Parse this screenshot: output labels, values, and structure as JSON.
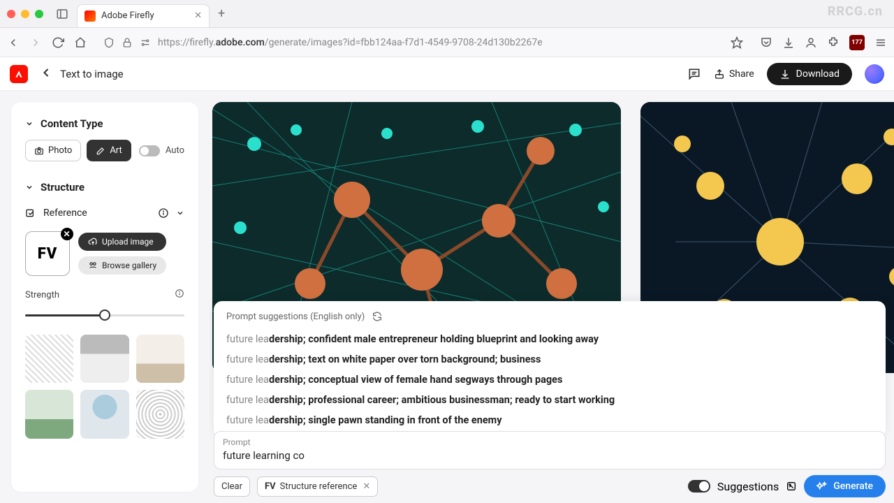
{
  "browser": {
    "tab_title": "Adobe Firefly",
    "url_prefix": "https://firefly.",
    "url_domain": "adobe.com",
    "url_path": "/generate/images?id=fbb124aa-f7d1-4549-9708-24d130b2267e",
    "ublock_badge": "177",
    "new_tab_symbol": "+"
  },
  "header": {
    "breadcrumb": "Text to image",
    "share_label": "Share",
    "download_label": "Download"
  },
  "sidebar": {
    "content_type_label": "Content Type",
    "photo_label": "Photo",
    "art_label": "Art",
    "auto_label": "Auto",
    "structure_label": "Structure",
    "reference_label": "Reference",
    "ref_thumb_text": "FV",
    "upload_label": "Upload image",
    "browse_label": "Browse gallery",
    "strength_label": "Strength"
  },
  "popover": {
    "heading": "Prompt suggestions (English only)",
    "prefix_text": "future lea",
    "items": [
      "dership; confident male entrepreneur holding blueprint and looking away",
      "dership; text on white paper over torn background; business",
      "dership; conceptual view of female hand segways through pages",
      "dership; professional career; ambitious businessman; ready to start working",
      "dership; single pawn standing in front of the enemy"
    ]
  },
  "prompt": {
    "label": "Prompt",
    "value": "future learning co",
    "clear_label": "Clear",
    "structure_chip_prefix": "FV",
    "structure_chip_label": "Structure reference",
    "suggestions_label": "Suggestions",
    "generate_label": "Generate"
  },
  "watermark": "RRCG.cn"
}
